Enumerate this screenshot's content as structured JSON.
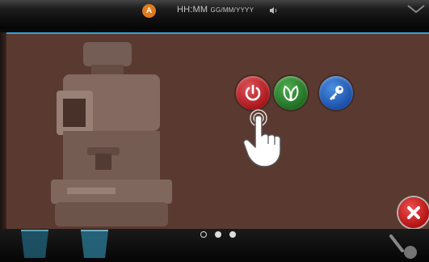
{
  "status_bar": {
    "alert_badge": "A",
    "time_label": "HH:MM",
    "date_label": "GG/MM/YYYY",
    "volume_icon": "volume-icon",
    "menu_icon": "chevron-down-icon"
  },
  "popup": {
    "background_image": "coffee-machine-illustration",
    "buttons": [
      {
        "icon": "power-icon",
        "color": "#c0262c"
      },
      {
        "icon": "eco-leaf-icon",
        "color": "#2e8b33"
      },
      {
        "icon": "key-icon",
        "color": "#2a6cc8"
      }
    ],
    "gesture_hint": "hand-tap-icon",
    "close_icon": "close-icon",
    "accent_color": "#2fa4da"
  },
  "pager": {
    "count": 3,
    "active_index": 0
  }
}
